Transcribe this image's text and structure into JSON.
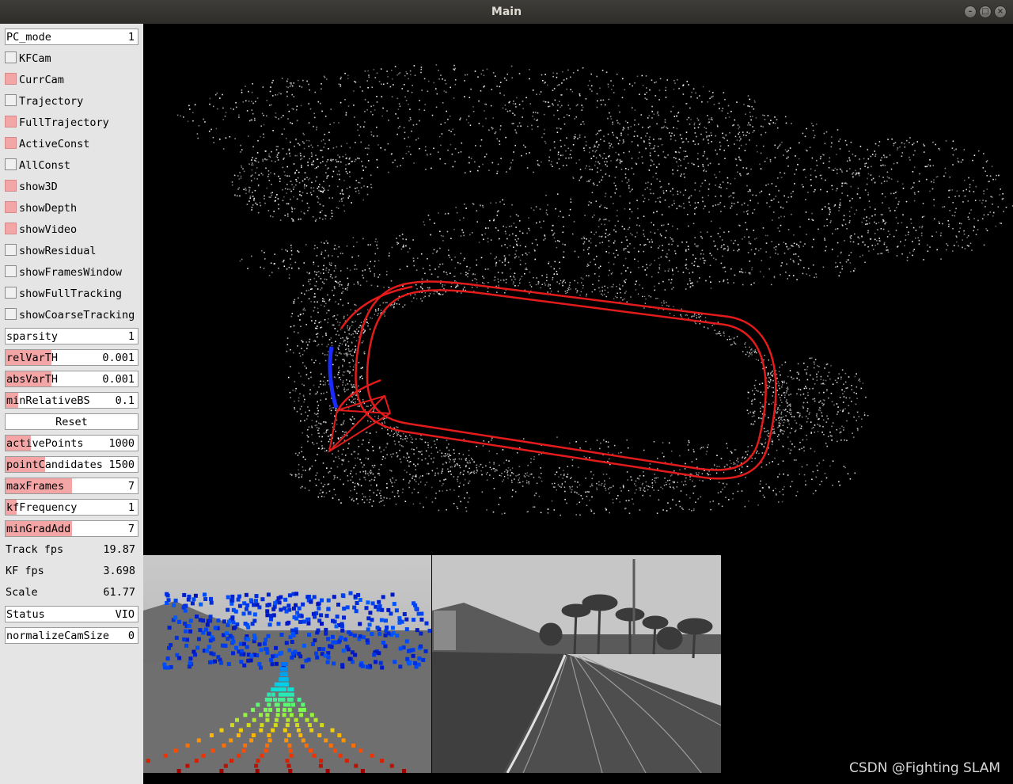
{
  "window": {
    "title": "Main"
  },
  "panel": {
    "pc_mode": {
      "label": "PC_mode",
      "value": "1"
    },
    "checkboxes": [
      {
        "label": "KFCam",
        "checked": false
      },
      {
        "label": "CurrCam",
        "checked": true
      },
      {
        "label": "Trajectory",
        "checked": false
      },
      {
        "label": "FullTrajectory",
        "checked": true
      },
      {
        "label": "ActiveConst",
        "checked": true
      },
      {
        "label": "AllConst",
        "checked": false
      },
      {
        "label": "show3D",
        "checked": true
      },
      {
        "label": "showDepth",
        "checked": true
      },
      {
        "label": "showVideo",
        "checked": true
      },
      {
        "label": "showResidual",
        "checked": false
      },
      {
        "label": "showFramesWindow",
        "checked": false
      },
      {
        "label": "showFullTracking",
        "checked": false
      },
      {
        "label": "showCoarseTracking",
        "checked": false
      }
    ],
    "sparsity": {
      "label": "sparsity",
      "value": "1"
    },
    "relVarTH": {
      "label": "relVarTH",
      "value": "0.001"
    },
    "absVarTH": {
      "label": "absVarTH",
      "value": "0.001"
    },
    "minRelativeBS": {
      "label": "minRelativeBS",
      "value": "0.1"
    },
    "reset": {
      "label": "Reset"
    },
    "activePoints": {
      "label": "activePoints",
      "value": "1000"
    },
    "pointCandidates": {
      "label": "pointCandidates",
      "value": "1500"
    },
    "maxFrames": {
      "label": "maxFrames",
      "value": "7"
    },
    "kfFrequency": {
      "label": "kfFrequency",
      "value": "1"
    },
    "minGradAdd": {
      "label": "minGradAdd",
      "value": "7"
    },
    "track_fps": {
      "label": "Track fps",
      "value": "19.87"
    },
    "kf_fps": {
      "label": "KF fps",
      "value": "3.698"
    },
    "scale": {
      "label": "Scale",
      "value": "61.77"
    },
    "status": {
      "label": "Status",
      "value": "VIO"
    },
    "normalizeCamSize": {
      "label": "normalizeCamSize",
      "value": "0"
    }
  },
  "colors": {
    "panel_bg": "#e5e5e5",
    "slider_fill": "#f4a6a6",
    "trajectory": "#e31b1b",
    "current_camera": "#1a2bff"
  },
  "watermark": "CSDN @Fighting SLAM"
}
